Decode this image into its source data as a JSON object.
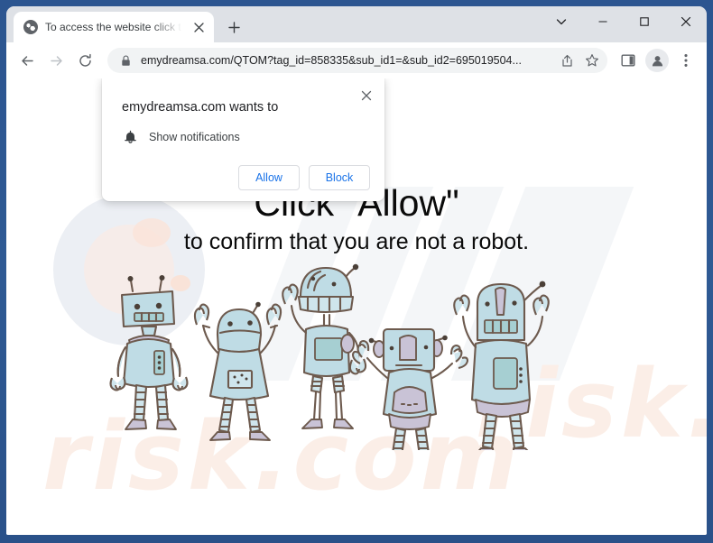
{
  "window": {
    "controls": {
      "tab_search": "tab-search",
      "minimize": "minimize",
      "maximize": "maximize",
      "close": "close"
    }
  },
  "tabstrip": {
    "tab": {
      "title": "To access the website click the \"A",
      "favicon": "globe-icon",
      "close": "×"
    },
    "new_tab": "+"
  },
  "toolbar": {
    "back": "←",
    "forward": "→",
    "reload": "⟳",
    "omnibox": {
      "lock": "lock-icon",
      "url": "emydreamsa.com/QTOM?tag_id=858335&sub_id1=&sub_id2=695019504...",
      "share": "share-icon",
      "bookmark": "star-icon"
    },
    "side_panel": "side-panel-icon",
    "profile": "profile-avatar",
    "menu": "⋮"
  },
  "notification_dialog": {
    "title": "emydreamsa.com wants to",
    "permission": "Show notifications",
    "permission_icon": "bell-icon",
    "close": "×",
    "allow_label": "Allow",
    "block_label": "Block"
  },
  "page": {
    "headline_line1": "Click \"Allow\"",
    "headline_line2": "to confirm that you are not a robot.",
    "watermark_text": "risk.com",
    "illustration": "five-cartoon-robots"
  },
  "colors": {
    "frame_blue": "#2f5a94",
    "tabstrip_gray": "#dee1e6",
    "omnibox_gray": "#f1f3f4",
    "link_blue": "#1a73e8",
    "text_dark": "#202124",
    "robot_body": "#b9dce6",
    "robot_outline": "#6d5a4e",
    "watermark_peach": "#fbeee7",
    "watermark_gray": "#eceff4"
  }
}
